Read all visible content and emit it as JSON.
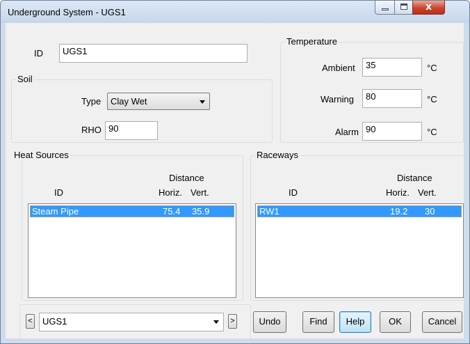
{
  "window": {
    "title": "Underground System - UGS1",
    "close_glyph": "x"
  },
  "id_field": {
    "label": "ID",
    "value": "UGS1"
  },
  "soil": {
    "legend": "Soil",
    "type_label": "Type",
    "type_value": "Clay Wet",
    "rho_label": "RHO",
    "rho_value": "90"
  },
  "temperature": {
    "legend": "Temperature",
    "unit": "°C",
    "ambient_label": "Ambient",
    "ambient_value": "35",
    "warning_label": "Warning",
    "warning_value": "80",
    "alarm_label": "Alarm",
    "alarm_value": "90"
  },
  "heat_sources": {
    "legend": "Heat Sources",
    "distance_header": "Distance",
    "col_id": "ID",
    "col_horiz": "Horiz.",
    "col_vert": "Vert.",
    "rows": [
      {
        "id": "Steam Pipe",
        "horiz": "75.4",
        "vert": "35.9"
      }
    ]
  },
  "raceways": {
    "legend": "Raceways",
    "distance_header": "Distance",
    "col_id": "ID",
    "col_horiz": "Horiz.",
    "col_vert": "Vert.",
    "rows": [
      {
        "id": "RW1",
        "horiz": "19.2",
        "vert": "30"
      }
    ]
  },
  "footer": {
    "prev": "<",
    "next": ">",
    "selector_value": "UGS1",
    "undo": "Undo",
    "find": "Find",
    "help": "Help",
    "ok": "OK",
    "cancel": "Cancel"
  }
}
